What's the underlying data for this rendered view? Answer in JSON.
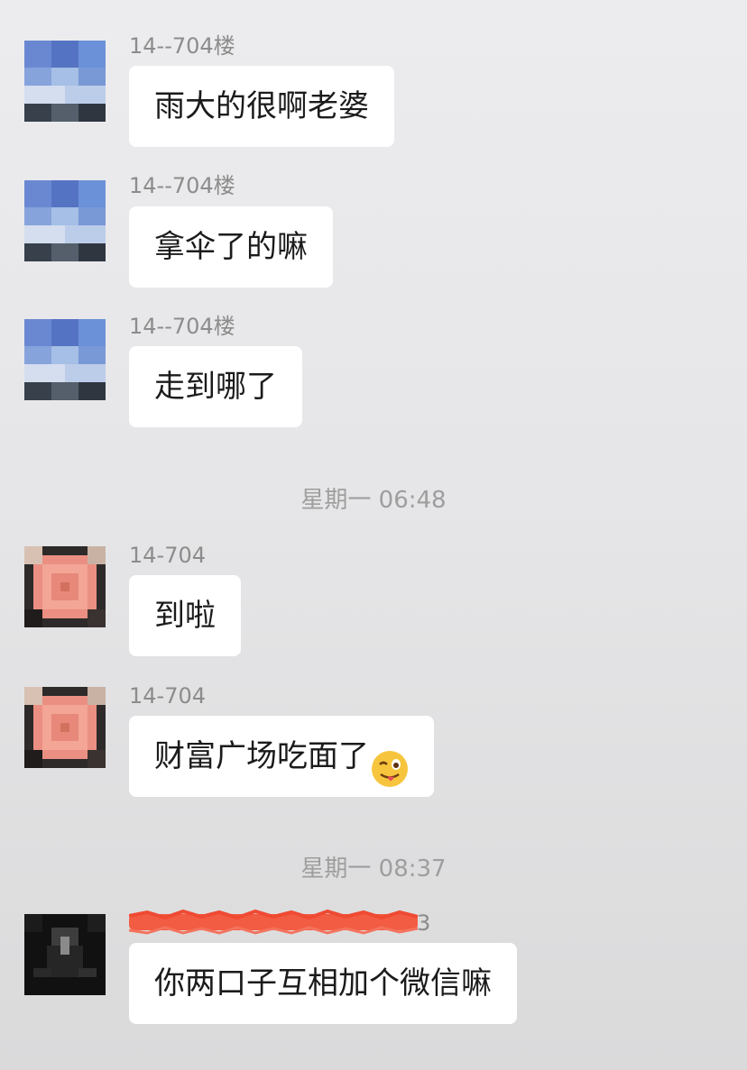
{
  "messages": [
    {
      "sender": "14--704楼",
      "text": "雨大的很啊老婆"
    },
    {
      "sender": "14--704楼",
      "text": "拿伞了的嘛"
    },
    {
      "sender": "14--704楼",
      "text": "走到哪了"
    },
    {
      "sender": "14-704",
      "text": "到啦"
    },
    {
      "sender": "14-704",
      "text": "财富广场吃面了"
    },
    {
      "sender_tail": "3",
      "text": "你两口子互相加个微信嘛"
    }
  ],
  "timestamps": [
    "星期一 06:48",
    "星期一 08:37"
  ],
  "icons": {
    "wink_emoji": "winking-face-with-tongue-icon"
  }
}
